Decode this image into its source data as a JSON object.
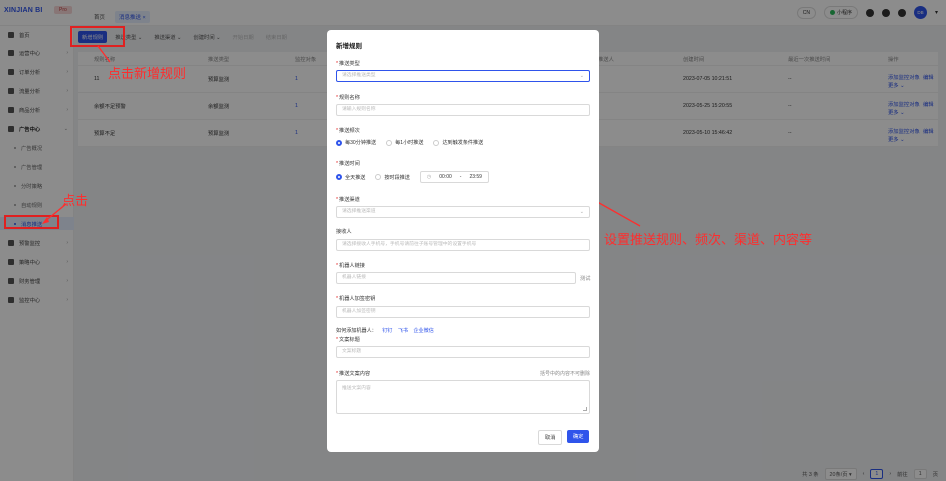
{
  "app": {
    "logo": "XINJIAN BI",
    "badge": "Pro"
  },
  "tabs": [
    {
      "label": "首页"
    },
    {
      "label": "消息推送 ×"
    }
  ],
  "topbar": {
    "lang": "CN",
    "mini_program": "小程序",
    "avatar": "DB"
  },
  "sidebar": {
    "items": [
      {
        "label": "首页"
      },
      {
        "label": "运营中心"
      },
      {
        "label": "订单分析"
      },
      {
        "label": "流量分析"
      },
      {
        "label": "商品分析"
      },
      {
        "label": "广告中心"
      },
      {
        "label": "广告概况"
      },
      {
        "label": "广告管理"
      },
      {
        "label": "分时策略"
      },
      {
        "label": "自动规则"
      },
      {
        "label": "消息推送"
      },
      {
        "label": "预警监控"
      },
      {
        "label": "策略中心"
      },
      {
        "label": "财务管理"
      },
      {
        "label": "监控中心"
      }
    ]
  },
  "filters": {
    "new_rule": "新增规则",
    "push_type": "推送类型 ⌄",
    "push_channel": "推送渠道 ⌄",
    "created": "创建时间 ⌄",
    "start_date": "开始日期",
    "end_date": "结束日期"
  },
  "table": {
    "headers": [
      "规则名称",
      "推送类型",
      "监控对象",
      "推送人",
      "创建时间",
      "最近一次推送时间",
      "操作"
    ],
    "rows": [
      {
        "name": "11",
        "type": "预算监测",
        "count": "1",
        "created": "2023-07-05 10:21:51",
        "last": "--",
        "op1": "添加监控对象",
        "op2": "编辑",
        "more": "更多 ⌄"
      },
      {
        "name": "余额不足预警",
        "type": "余额监测",
        "count": "1",
        "created": "2023-05-25 15:20:55",
        "last": "--",
        "op1": "添加监控对象",
        "op2": "编辑",
        "more": "更多 ⌄"
      },
      {
        "name": "预算不足",
        "type": "预算监测",
        "count": "1",
        "created": "2023-05-10 15:46:42",
        "last": "--",
        "op1": "添加监控对象",
        "op2": "编辑",
        "more": "更多 ⌄"
      }
    ]
  },
  "pagination": {
    "total": "共 3 条",
    "per_page": "20条/页 ▾",
    "page": "1",
    "goto": "前往",
    "goto_page": "1",
    "unit": "页"
  },
  "annotations": {
    "click_new_rule": "点击新增规则",
    "click": "点击",
    "set_rules": "设置推送规则、频次、渠道、内容等"
  },
  "modal": {
    "title": "新增规则",
    "push_type_label": "推送类型",
    "push_type_placeholder": "请选择推送类型",
    "rule_name_label": "规则名称",
    "rule_name_placeholder": "请输入规则名称",
    "frequency_label": "推送频次",
    "frequency_options": [
      "每30分钟推送",
      "每1小时推送",
      "达到触发条件推送"
    ],
    "time_label": "推送时间",
    "time_options": [
      "全天推送",
      "按时段推送"
    ],
    "time_start": "00:00",
    "time_sep": "-",
    "time_end": "23:59",
    "channel_label": "推送渠道",
    "channel_placeholder": "请选择推送渠道",
    "receiver_label": "接收人",
    "receiver_placeholder": "请选择接收人手机号，手机号请前往子账号管理中的设置手机号",
    "robot_link_label": "机器人链接",
    "robot_link_placeholder": "机器人链接",
    "test_label": "测试",
    "robot_secret_label": "机器人加签密钥",
    "robot_secret_placeholder": "机器人加签密钥",
    "how_to": "如何添加机器人：",
    "links": [
      "钉钉",
      "飞书",
      "企业微信"
    ],
    "copy_title_label": "文案标题",
    "copy_title_placeholder": "文案标题",
    "copy_content_label": "推送文案内容",
    "copy_hint": "括号中的内容不可删除",
    "copy_content_placeholder": "推送文案内容",
    "cancel": "取消",
    "ok": "确定"
  },
  "colors": {
    "accent": "#2f54eb",
    "annotation": "#ff2d2d"
  }
}
